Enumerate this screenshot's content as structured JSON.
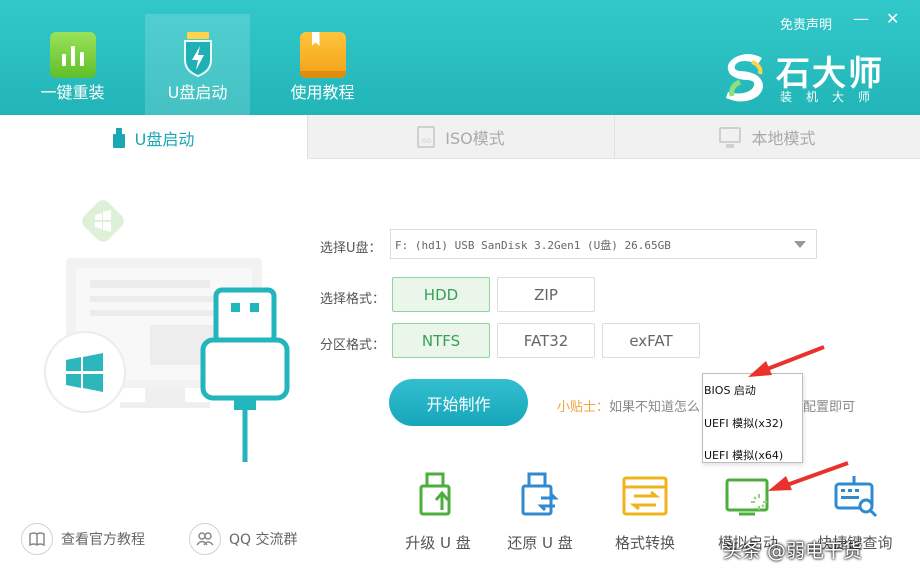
{
  "header": {
    "nav": [
      {
        "label": "一键重装",
        "icon": "bar-chart-icon"
      },
      {
        "label": "U盘启动",
        "icon": "shield-bolt-icon"
      },
      {
        "label": "使用教程",
        "icon": "book-icon"
      }
    ],
    "active_nav": "U盘启动",
    "disclaimer": "免责声明",
    "minimize": "—",
    "close": "✕",
    "brand_name": "石大师",
    "brand_sub": "装机大师"
  },
  "tabs": [
    {
      "label": "U盘启动",
      "icon": "usb-icon"
    },
    {
      "label": "ISO模式",
      "icon": "iso-file-icon"
    },
    {
      "label": "本地模式",
      "icon": "monitor-icon"
    }
  ],
  "form": {
    "usb_label": "选择U盘：",
    "usb_value": "F: (hd1) USB SanDisk 3.2Gen1 (U盘) 26.65GB",
    "format_label": "选择格式：",
    "format_options": [
      "HDD",
      "ZIP"
    ],
    "format_selected": "HDD",
    "partition_label": "分区格式：",
    "partition_options": [
      "NTFS",
      "FAT32",
      "exFAT"
    ],
    "partition_selected": "NTFS",
    "start_button": "开始制作",
    "tip_key": "小贴士：",
    "tip_text": "如果不知道怎么",
    "tip_tail": "配置即可"
  },
  "menu": {
    "items": [
      "BIOS 启动",
      "UEFI 模拟(x32)",
      "UEFI 模拟(x64)"
    ]
  },
  "tools": [
    {
      "label": "升级 U 盘",
      "icon": "usb-upgrade-icon"
    },
    {
      "label": "还原 U 盘",
      "icon": "usb-restore-icon"
    },
    {
      "label": "格式转换",
      "icon": "format-convert-icon"
    },
    {
      "label": "模拟启动",
      "icon": "simulate-boot-icon"
    },
    {
      "label": "快捷键查询",
      "icon": "keyboard-search-icon"
    }
  ],
  "bottom_links": [
    {
      "label": "查看官方教程",
      "icon": "book-open-icon"
    },
    {
      "label": "QQ 交流群",
      "icon": "group-icon"
    }
  ],
  "watermark": "头条 @弱电干货",
  "colors": {
    "header_teal": "#22b5b8",
    "accent": "#1ba7b3",
    "selected_green": "#3a9e5a",
    "tip_orange": "#f2a33a",
    "arrow_red": "#e8322b"
  }
}
